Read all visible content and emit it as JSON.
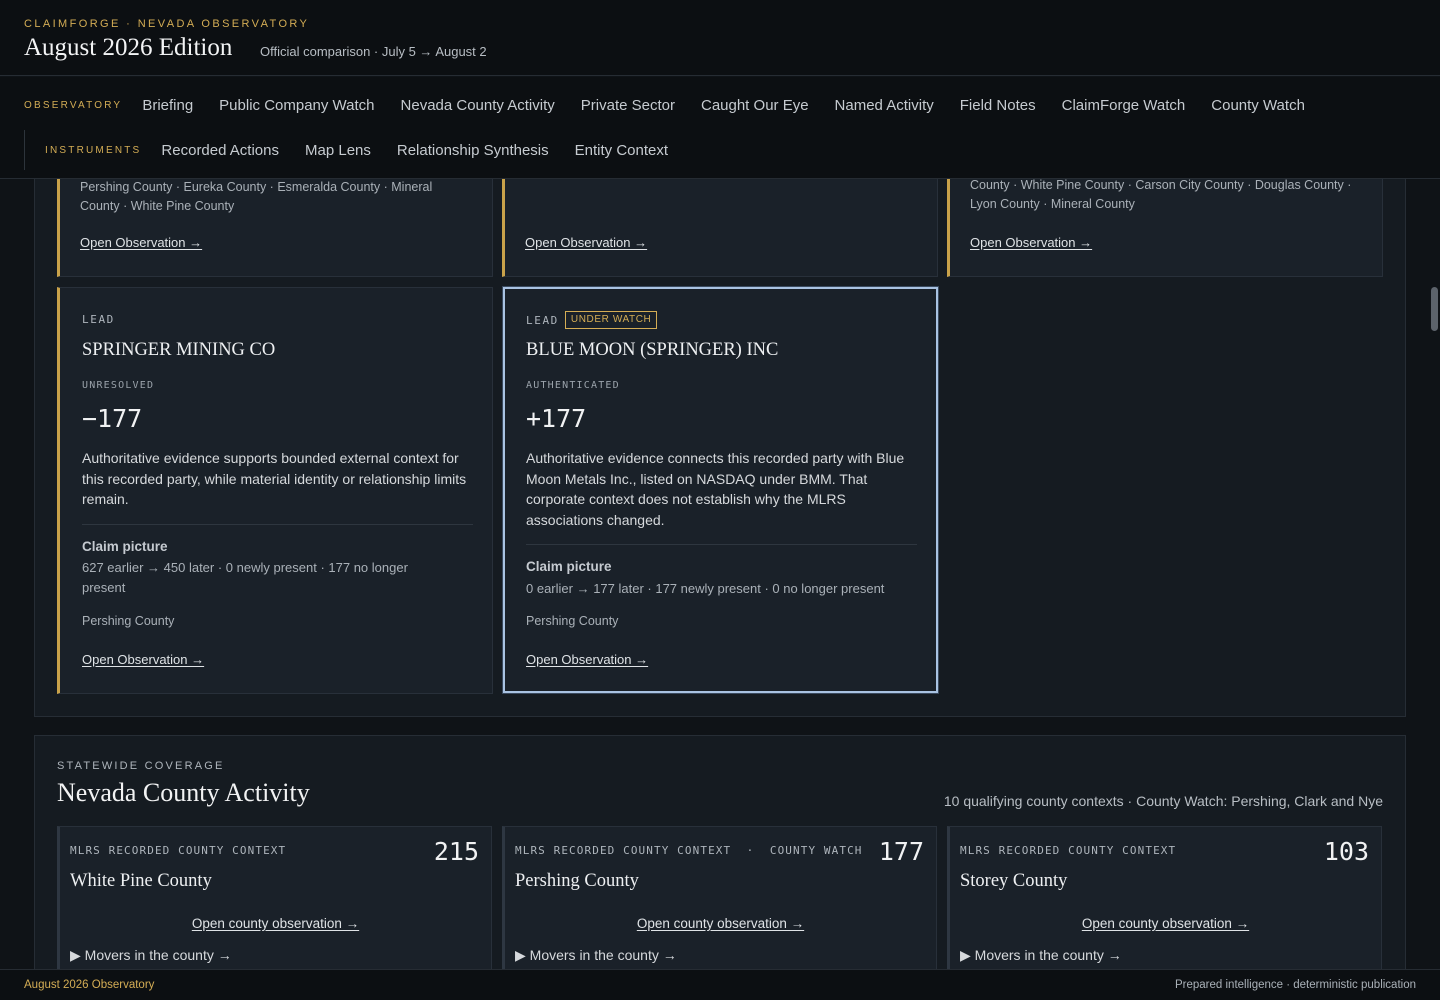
{
  "header": {
    "kicker": "CLAIMFORGE · NEVADA OBSERVATORY",
    "title": "August 2026 Edition",
    "subtitle": "Official comparison · July 5 → August 2"
  },
  "nav": {
    "observatory_label": "OBSERVATORY",
    "observatory_links": [
      "Briefing",
      "Public Company Watch",
      "Nevada County Activity",
      "Private Sector",
      "Caught Our Eye",
      "Named Activity",
      "Field Notes",
      "ClaimForge Watch",
      "County Watch"
    ],
    "instruments_label": "INSTRUMENTS",
    "instrument_links": [
      "Recorded Actions",
      "Map Lens",
      "Relationship Synthesis",
      "Entity Context"
    ]
  },
  "partial_cards": [
    {
      "counties": "Pershing County · Eureka County · Esmeralda County · Mineral County · White Pine County",
      "link": "Open Observation →"
    },
    {
      "counties": "",
      "link": "Open Observation →"
    },
    {
      "counties": "County · White Pine County · Carson City County · Douglas County · Lyon County · Mineral County",
      "link": "Open Observation →"
    }
  ],
  "lead_cards": [
    {
      "kicker": "LEAD",
      "badge": "",
      "name": "SPRINGER MINING CO",
      "status": "UNRESOLVED",
      "delta": "−177",
      "body": "Authoritative evidence supports bounded external context for this recorded party, while material identity or relationship limits remain.",
      "claim_title": "Claim picture",
      "claim_text": "627 earlier → 450 later · 0 newly present · 177 no longer present",
      "county": "Pershing County",
      "link": "Open Observation →"
    },
    {
      "kicker": "LEAD",
      "badge": "UNDER WATCH",
      "name": "BLUE MOON (SPRINGER) INC",
      "status": "AUTHENTICATED",
      "delta": "+177",
      "body": "Authoritative evidence connects this recorded party with Blue Moon Metals Inc., listed on NASDAQ under BMM. That corporate context does not establish why the MLRS associations changed.",
      "claim_title": "Claim picture",
      "claim_text": "0 earlier → 177 later · 177 newly present · 0 no longer present",
      "county": "Pershing County",
      "link": "Open Observation →"
    }
  ],
  "county_section": {
    "kicker": "STATEWIDE COVERAGE",
    "title": "Nevada County Activity",
    "meta": "10 qualifying county contexts · County Watch: Pershing, Clark and Nye",
    "cards": [
      {
        "kicker": "MLRS RECORDED COUNTY CONTEXT",
        "count": "215",
        "name": "White Pine County",
        "link": "Open county observation →",
        "movers": "▶ Movers in the county →"
      },
      {
        "kicker": "MLRS RECORDED COUNTY CONTEXT  ·  COUNTY WATCH",
        "count": "177",
        "name": "Pershing County",
        "link": "Open county observation →",
        "movers": "▶ Movers in the county →"
      },
      {
        "kicker": "MLRS RECORDED COUNTY CONTEXT",
        "count": "103",
        "name": "Storey County",
        "link": "Open county observation →",
        "movers": "▶ Movers in the county →"
      }
    ]
  },
  "footer": {
    "left": "August 2026 Observatory",
    "right": "Prepared intelligence · deterministic publication"
  }
}
